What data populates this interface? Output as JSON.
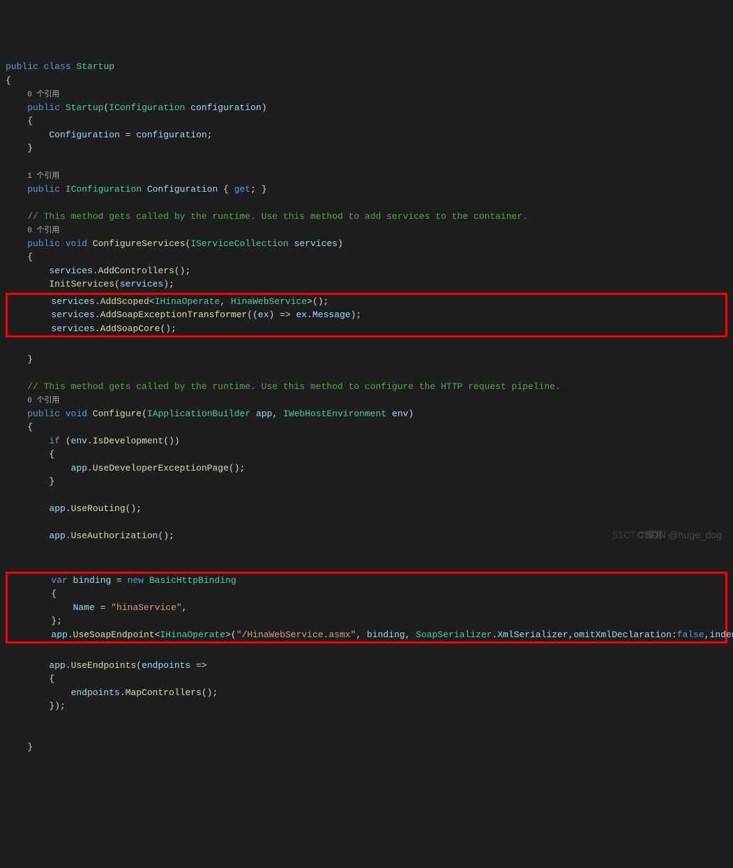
{
  "lines": {
    "l1_public": "public",
    "l1_class": "class",
    "l1_name": "Startup",
    "l2_brace": "{",
    "l3_ref": "0 个引用",
    "l4_public": "public",
    "l4_name": "Startup",
    "l4_paren_o": "(",
    "l4_type": "IConfiguration",
    "l4_param": "configuration",
    "l4_paren_c": ")",
    "l5_brace": "{",
    "l6_var": "Configuration",
    "l6_eq": " = ",
    "l6_val": "configuration",
    "l6_semi": ";",
    "l7_brace": "}",
    "l8_ref": "1 个引用",
    "l9_public": "public",
    "l9_type": "IConfiguration",
    "l9_name": "Configuration",
    "l9_bo": " { ",
    "l9_get": "get",
    "l9_semi": "; ",
    "l9_bc": "}",
    "l10_comment": "// This method gets called by the runtime. Use this method to add services to the container.",
    "l11_ref": "0 个引用",
    "l12_public": "public",
    "l12_void": "void",
    "l12_name": "ConfigureServices",
    "l12_po": "(",
    "l12_type": "IServiceCollection",
    "l12_param": "services",
    "l12_pc": ")",
    "l13_brace": "{",
    "l14_var": "services",
    "l14_dot": ".",
    "l14_method": "AddControllers",
    "l14_end": "();",
    "l15_method": "InitServices",
    "l15_po": "(",
    "l15_var": "services",
    "l15_pc": ");",
    "l16_var": "services",
    "l16_dot": ".",
    "l16_method": "AddScoped",
    "l16_lt": "<",
    "l16_t1": "IHinaOperate",
    "l16_comma": ", ",
    "l16_t2": "HinaWebService",
    "l16_gt": ">",
    "l16_end": "();",
    "l17_var": "services",
    "l17_dot": ".",
    "l17_method": "AddSoapExceptionTransformer",
    "l17_po": "((",
    "l17_ex": "ex",
    "l17_arr": ") => ",
    "l17_ex2": "ex",
    "l17_dot2": ".",
    "l17_msg": "Message",
    "l17_end": ");",
    "l18_var": "services",
    "l18_dot": ".",
    "l18_method": "AddSoapCore",
    "l18_end": "();",
    "l19_brace": "}",
    "l20_comment": "// This method gets called by the runtime. Use this method to configure the HTTP request pipeline.",
    "l21_ref": "0 个引用",
    "l22_public": "public",
    "l22_void": "void",
    "l22_name": "Configure",
    "l22_po": "(",
    "l22_t1": "IApplicationBuilder",
    "l22_p1": "app",
    "l22_c": ", ",
    "l22_t2": "IWebHostEnvironment",
    "l22_p2": "env",
    "l22_pc": ")",
    "l23_brace": "{",
    "l24_if": "if",
    "l24_po": " (",
    "l24_env": "env",
    "l24_dot": ".",
    "l24_method": "IsDevelopment",
    "l24_end": "())",
    "l25_brace": "{",
    "l26_app": "app",
    "l26_dot": ".",
    "l26_method": "UseDeveloperExceptionPage",
    "l26_end": "();",
    "l27_brace": "}",
    "l28_app": "app",
    "l28_dot": ".",
    "l28_method": "UseRouting",
    "l28_end": "();",
    "l29_app": "app",
    "l29_dot": ".",
    "l29_method": "UseAuthorization",
    "l29_end": "();",
    "l30_var": "var",
    "l30_name": "binding",
    "l30_eq": " = ",
    "l30_new": "new",
    "l30_type": " BasicHttpBinding",
    "l31_brace": "{",
    "l32_name": "Name",
    "l32_eq": " = ",
    "l32_str": "\"hinaService\"",
    "l32_comma": ",",
    "l33_brace": "};",
    "l34_app": "app",
    "l34_dot": ".",
    "l34_method": "UseSoapEndpoint",
    "l34_lt": "<",
    "l34_type": "IHinaOperate",
    "l34_gt": ">",
    "l34_po": "(",
    "l34_str": "\"/HinaWebService.asmx\"",
    "l34_c1": ", ",
    "l34_binding": "binding",
    "l34_c2": ", ",
    "l34_ser": "SoapSerializer",
    "l34_dot2": ".",
    "l34_xml": "XmlSerializer",
    "l34_c3": ",",
    "l34_omit": "omitXmlDeclaration",
    "l34_colon1": ":",
    "l34_false1": "false",
    "l34_c4": ",",
    "l34_indent": "indentXml",
    "l34_colon2": ":",
    "l34_false2": "false",
    "l34_end": ");",
    "l35_app": "app",
    "l35_dot": ".",
    "l35_method": "UseEndpoints",
    "l35_po": "(",
    "l35_ep": "endpoints",
    "l35_arr": " =>",
    "l36_brace": "{",
    "l37_ep": "endpoints",
    "l37_dot": ".",
    "l37_method": "MapControllers",
    "l37_end": "();",
    "l38_brace": "});",
    "l39_brace": "}"
  },
  "watermark1": "CSDN @huge_dog",
  "watermark2": "51CTO博客"
}
